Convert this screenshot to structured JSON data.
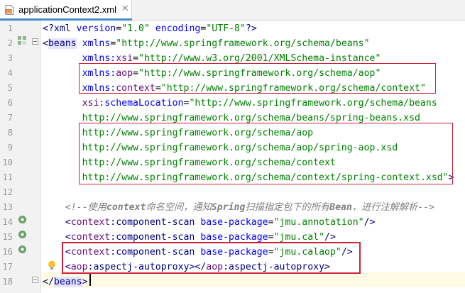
{
  "tab": {
    "label": "applicationContext2.xml",
    "close_glyph": "✕",
    "icon": "xml-file-icon"
  },
  "editor": {
    "line_numbers": [
      "1",
      "2",
      "3",
      "4",
      "5",
      "6",
      "7",
      "8",
      "9",
      "10",
      "11",
      "12",
      "13",
      "14",
      "15",
      "16",
      "17",
      "18"
    ],
    "lines": [
      [
        {
          "t": "<?",
          "c": "tag"
        },
        {
          "t": "xml ",
          "c": "tag"
        },
        {
          "t": "version",
          "c": "attr"
        },
        {
          "t": "=",
          "c": "plain"
        },
        {
          "t": "\"1.0\"",
          "c": "val"
        },
        {
          "t": " ",
          "c": "plain"
        },
        {
          "t": "encoding",
          "c": "attr"
        },
        {
          "t": "=",
          "c": "plain"
        },
        {
          "t": "\"UTF-8\"",
          "c": "val"
        },
        {
          "t": "?>",
          "c": "tag"
        }
      ],
      [
        {
          "t": "<",
          "c": "tag"
        },
        {
          "t": "beans",
          "c": "tag-hl"
        },
        {
          "t": " ",
          "c": "plain"
        },
        {
          "t": "xmlns",
          "c": "attr"
        },
        {
          "t": "=",
          "c": "plain"
        },
        {
          "t": "\"http://www.springframework.org/schema/beans\"",
          "c": "val"
        }
      ],
      [
        {
          "t": "       ",
          "c": "plain"
        },
        {
          "t": "xmlns",
          "c": "attr"
        },
        {
          "t": ":",
          "c": "attr"
        },
        {
          "t": "xsi",
          "c": "ns"
        },
        {
          "t": "=",
          "c": "plain"
        },
        {
          "t": "\"http://www.w3.org/2001/XMLSchema-instance\"",
          "c": "val"
        }
      ],
      [
        {
          "t": "       ",
          "c": "plain"
        },
        {
          "t": "xmlns",
          "c": "attr"
        },
        {
          "t": ":",
          "c": "attr"
        },
        {
          "t": "aop",
          "c": "ns"
        },
        {
          "t": "=",
          "c": "plain"
        },
        {
          "t": "\"http://www.springframework.org/schema/aop\"",
          "c": "val"
        }
      ],
      [
        {
          "t": "       ",
          "c": "plain"
        },
        {
          "t": "xmlns",
          "c": "attr"
        },
        {
          "t": ":",
          "c": "attr"
        },
        {
          "t": "context",
          "c": "ns"
        },
        {
          "t": "=",
          "c": "plain"
        },
        {
          "t": "\"http://www.springframework.org/schema/context\"",
          "c": "val"
        }
      ],
      [
        {
          "t": "       ",
          "c": "plain"
        },
        {
          "t": "xsi",
          "c": "ns"
        },
        {
          "t": ":schemaLocation",
          "c": "attr"
        },
        {
          "t": "=",
          "c": "plain"
        },
        {
          "t": "\"http://www.springframework.org/schema/beans",
          "c": "val"
        }
      ],
      [
        {
          "t": "       ",
          "c": "plain"
        },
        {
          "t": "http://www.springframework.org/schema/beans/spring-beans.xsd",
          "c": "val"
        }
      ],
      [
        {
          "t": "       ",
          "c": "plain"
        },
        {
          "t": "http://www.springframework.org/schema/aop",
          "c": "val"
        }
      ],
      [
        {
          "t": "       ",
          "c": "plain"
        },
        {
          "t": "http://www.springframework.org/schema/aop/spring-aop.xsd",
          "c": "val"
        }
      ],
      [
        {
          "t": "       ",
          "c": "plain"
        },
        {
          "t": "http://www.springframework.org/schema/context",
          "c": "val"
        }
      ],
      [
        {
          "t": "       ",
          "c": "plain"
        },
        {
          "t": "http://www.springframework.org/schema/context/spring-context.xsd\"",
          "c": "val"
        },
        {
          "t": ">",
          "c": "tag"
        }
      ],
      [],
      [
        {
          "t": "    <!--",
          "c": "comment"
        },
        {
          "t": "使用",
          "c": "comment"
        },
        {
          "t": "context",
          "c": "cmt-bold"
        },
        {
          "t": "命名空间，通知",
          "c": "comment"
        },
        {
          "t": "Spring",
          "c": "cmt-bold"
        },
        {
          "t": "扫描指定包下的所有",
          "c": "comment"
        },
        {
          "t": "Bean",
          "c": "cmt-bold"
        },
        {
          "t": "，进行注解解析",
          "c": "comment"
        },
        {
          "t": "-->",
          "c": "comment"
        }
      ],
      [
        {
          "t": "    <",
          "c": "tag"
        },
        {
          "t": "context",
          "c": "ns"
        },
        {
          "t": ":component-scan",
          "c": "tag"
        },
        {
          "t": " ",
          "c": "plain"
        },
        {
          "t": "base-package",
          "c": "attr"
        },
        {
          "t": "=",
          "c": "plain"
        },
        {
          "t": "\"jmu.annotation\"",
          "c": "val"
        },
        {
          "t": "/>",
          "c": "tag"
        }
      ],
      [
        {
          "t": "    <",
          "c": "tag"
        },
        {
          "t": "context",
          "c": "ns"
        },
        {
          "t": ":component-scan",
          "c": "tag"
        },
        {
          "t": " ",
          "c": "plain"
        },
        {
          "t": "base-package",
          "c": "attr"
        },
        {
          "t": "=",
          "c": "plain"
        },
        {
          "t": "\"jmu.cal\"",
          "c": "val"
        },
        {
          "t": "/>",
          "c": "tag"
        }
      ],
      [
        {
          "t": "    <",
          "c": "tag"
        },
        {
          "t": "context",
          "c": "ns"
        },
        {
          "t": ":component-scan",
          "c": "tag"
        },
        {
          "t": " ",
          "c": "plain"
        },
        {
          "t": "base-package",
          "c": "attr"
        },
        {
          "t": "=",
          "c": "plain"
        },
        {
          "t": "\"jmu.calaop\"",
          "c": "val"
        },
        {
          "t": "/>",
          "c": "tag"
        }
      ],
      [
        {
          "t": "    <",
          "c": "tag"
        },
        {
          "t": "aop",
          "c": "ns"
        },
        {
          "t": ":aspectj-autoproxy",
          "c": "tag"
        },
        {
          "t": "></",
          "c": "tag"
        },
        {
          "t": "aop",
          "c": "ns"
        },
        {
          "t": ":aspectj-autoproxy",
          "c": "tag"
        },
        {
          "t": ">",
          "c": "tag"
        }
      ],
      [
        {
          "t": "</",
          "c": "tag"
        },
        {
          "t": "beans",
          "c": "tag-hl"
        },
        {
          "t": ">",
          "c": "tag"
        }
      ]
    ]
  },
  "colors": {
    "highlight_box": "#d0213b",
    "tab_accent": "#4a88c7",
    "caret_line": "#fffae3"
  }
}
